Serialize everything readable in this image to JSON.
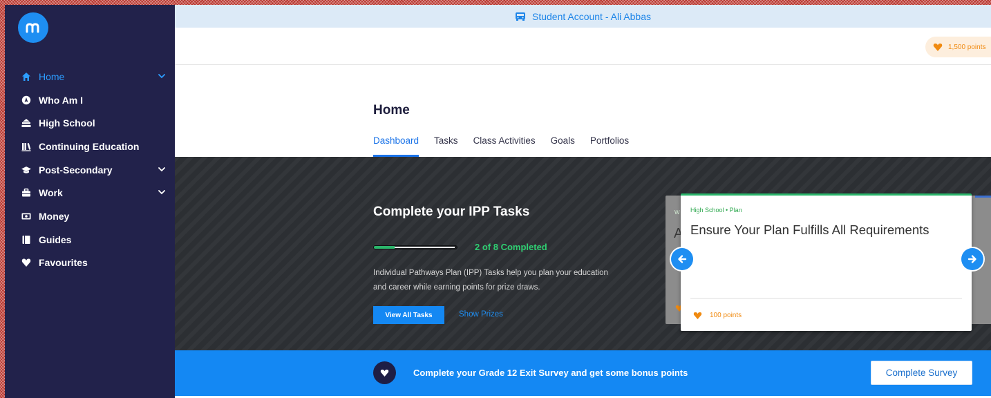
{
  "account_banner": {
    "text": "Student Account - Ali Abbas",
    "icon": "bus-icon"
  },
  "topbar": {
    "points_label": "1,500 points"
  },
  "sidebar": {
    "items": [
      {
        "label": "Home",
        "icon": "home-icon",
        "active": true,
        "has_chevron": true
      },
      {
        "label": "Who Am I",
        "icon": "compass-icon",
        "active": false,
        "has_chevron": false
      },
      {
        "label": "High School",
        "icon": "school-icon",
        "active": false,
        "has_chevron": false
      },
      {
        "label": "Continuing Education",
        "icon": "books-icon",
        "active": false,
        "has_chevron": false
      },
      {
        "label": "Post-Secondary",
        "icon": "graduation-cap-icon",
        "active": false,
        "has_chevron": true
      },
      {
        "label": "Work",
        "icon": "briefcase-icon",
        "active": false,
        "has_chevron": true
      },
      {
        "label": "Money",
        "icon": "money-icon",
        "active": false,
        "has_chevron": false
      },
      {
        "label": "Guides",
        "icon": "guide-book-icon",
        "active": false,
        "has_chevron": false
      },
      {
        "label": "Favourites",
        "icon": "heart-icon",
        "active": false,
        "has_chevron": false
      }
    ]
  },
  "header": {
    "title": "Home",
    "tabs": [
      {
        "label": "Dashboard",
        "active": true
      },
      {
        "label": "Tasks",
        "active": false
      },
      {
        "label": "Class Activities",
        "active": false
      },
      {
        "label": "Goals",
        "active": false
      },
      {
        "label": "Portfolios",
        "active": false
      }
    ]
  },
  "hero": {
    "title": "Complete your IPP Tasks",
    "progress_text": "2 of 8 Completed",
    "progress_completed": 2,
    "progress_total": 8,
    "description": "Individual Pathways Plan (IPP) Tasks help you plan your education and career while earning points for prize draws.",
    "primary_button": "View All Tasks",
    "secondary_link": "Show Prizes"
  },
  "card": {
    "category": "High School • Plan",
    "title": "Ensure Your Plan Fulfills All Requirements",
    "points": "100 points",
    "peek_letter": "A",
    "peek_category": "W"
  },
  "survey": {
    "text": "Complete your Grade 12 Exit Survey and get some bonus points",
    "button": "Complete Survey"
  },
  "colors": {
    "sidebar_bg": "#22224b",
    "accent": "#1488f3",
    "success": "#2bb56b",
    "points": "#f08a10"
  }
}
